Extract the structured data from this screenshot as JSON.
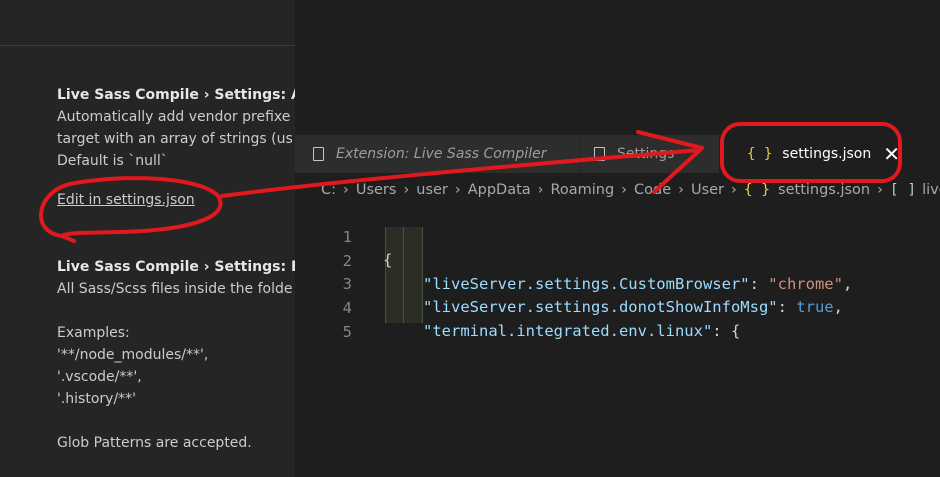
{
  "settings": {
    "item1": {
      "title": "Live Sass Compile › Settings: Aut",
      "desc_line1": "Automatically add vendor prefixe",
      "desc_line2": "target with an array of strings (us",
      "default_text": "Default is `null`",
      "edit_link": "Edit in settings.json"
    },
    "item2": {
      "title": "Live Sass Compile › Settings: Exc",
      "desc_line1": "All Sass/Scss files inside the folde",
      "examples_label": "Examples:",
      "examples": [
        "'**/node_modules/**',",
        "'.vscode/**',",
        "'.history/**'"
      ],
      "footer": "Glob Patterns are accepted."
    }
  },
  "tabs": [
    {
      "label": "Extension: Live Sass Compiler",
      "icon": "file-icon"
    },
    {
      "label": "Settings",
      "icon": "file-icon"
    },
    {
      "label": "settings.json",
      "icon": "braces-icon",
      "close": "✕"
    }
  ],
  "breadcrumb": {
    "items": [
      "C:",
      "Users",
      "user",
      "AppData",
      "Roaming",
      "Code",
      "User"
    ],
    "file_icon": "{ }",
    "file": "settings.json",
    "symbol_icon": "[ ]",
    "symbol": "liveSa"
  },
  "editor": {
    "line_numbers": [
      "1",
      "2",
      "3",
      "4",
      "5"
    ],
    "lines": [
      {
        "open": "{"
      },
      {
        "key": "\"liveServer.settings.CustomBrowser\"",
        "colon": ": ",
        "value": "\"chrome\"",
        "end": ","
      },
      {
        "key": "\"liveServer.settings.donotShowInfoMsg\"",
        "colon": ": ",
        "value": "true",
        "end": ","
      },
      {
        "key": "\"terminal.integrated.env.linux\"",
        "colon": ": ",
        "value": "{",
        "end": ""
      },
      {
        "open": ""
      }
    ]
  },
  "colors": {
    "annotation": "#e0191e",
    "string": "#ce9178",
    "key": "#9cdcfe",
    "boolean": "#569cd6"
  }
}
